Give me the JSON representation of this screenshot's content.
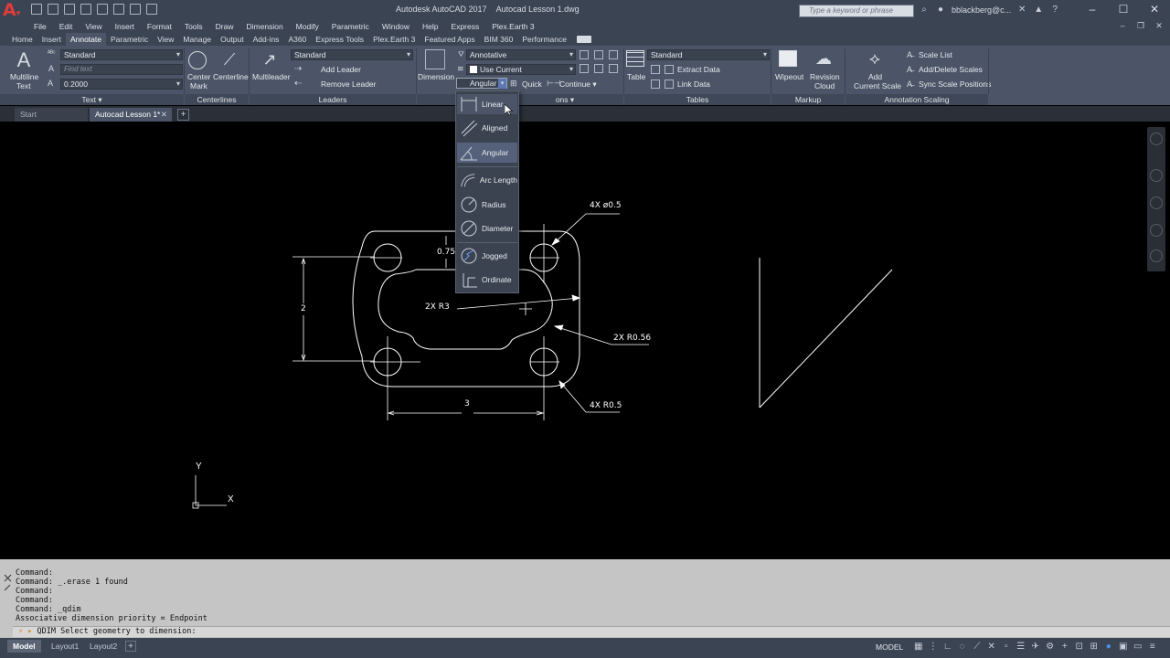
{
  "title": {
    "app_name": "Autodesk AutoCAD 2017",
    "file_name": "Autocad Lesson 1.dwg",
    "search_placeholder": "Type a keyword or phrase",
    "user": "bblackberg@c..."
  },
  "menu": {
    "items": [
      "File",
      "Edit",
      "View",
      "Insert",
      "Format",
      "Tools",
      "Draw",
      "Dimension",
      "Modify",
      "Parametric",
      "Window",
      "Help",
      "Express",
      "Plex.Earth 3"
    ]
  },
  "ribbon_tabs": {
    "items": [
      "Home",
      "Insert",
      "Annotate",
      "Parametric",
      "View",
      "Manage",
      "Output",
      "Add-ins",
      "A360",
      "Express Tools",
      "Plex.Earth 3",
      "Featured Apps",
      "BIM 360",
      "Performance"
    ],
    "active": "Annotate"
  },
  "ribbon": {
    "text_panel": {
      "title": "Text",
      "multiline_text_l1": "Multiline",
      "multiline_text_l2": "Text",
      "style": "Standard",
      "find_placeholder": "Find text",
      "height": "0.2000"
    },
    "centerlines_panel": {
      "title": "Centerlines",
      "center_mark_l1": "Center",
      "center_mark_l2": "Mark",
      "centerline": "Centerline"
    },
    "leaders_panel": {
      "title": "Leaders",
      "multileader": "Multileader",
      "style": "Standard",
      "add_leader": "Add Leader",
      "remove_leader": "Remove Leader"
    },
    "dimensions_panel": {
      "title_tail": "ons",
      "dimension": "Dimension",
      "style": "Annotative",
      "layer": "Use Current",
      "current_type": "Angular",
      "quick": "Quick",
      "continue": "Continue"
    },
    "tables_panel": {
      "title": "Tables",
      "table": "Table",
      "style": "Standard",
      "extract_data": "Extract Data",
      "link_data": "Link Data"
    },
    "markup_panel": {
      "title": "Markup",
      "wipeout": "Wipeout",
      "revision_cloud_l1": "Revision",
      "revision_cloud_l2": "Cloud"
    },
    "annotation_scaling_panel": {
      "title": "Annotation Scaling",
      "add_current_scale_l1": "Add",
      "add_current_scale_l2": "Current Scale",
      "scale_list": "Scale List",
      "add_delete_scales": "Add/Delete Scales",
      "sync_scale_positions": "Sync Scale Positions"
    }
  },
  "doc_tabs": {
    "start": "Start",
    "active": "Autocad Lesson 1*"
  },
  "dimension_dropdown": {
    "items": [
      {
        "label": "Linear",
        "icon": "linear-dim-icon"
      },
      {
        "label": "Aligned",
        "icon": "aligned-dim-icon"
      },
      {
        "label": "Angular",
        "icon": "angular-dim-icon"
      },
      {
        "label": "Arc Length",
        "icon": "arc-length-icon"
      },
      {
        "label": "Radius",
        "icon": "radius-icon"
      },
      {
        "label": "Diameter",
        "icon": "diameter-icon"
      },
      {
        "label": "Jogged",
        "icon": "jogged-icon"
      },
      {
        "label": "Ordinate",
        "icon": "ordinate-icon"
      }
    ],
    "selected": "Angular",
    "hovered": "Linear"
  },
  "drawing": {
    "dim_top": "0.75",
    "dim_left": "2",
    "dim_bottom": "3",
    "note_holes_top": "4X ø0.5",
    "note_slot": "2X R3",
    "note_fillet": "2X R0.56",
    "note_holes_bottom": "4X R0.5",
    "ucs_x": "X",
    "ucs_y": "Y"
  },
  "command": {
    "history": [
      "Command:",
      "Command: _.erase 1 found",
      "Command:",
      "Command:",
      "Command: _qdim",
      "Associative dimension priority = Endpoint"
    ],
    "prompt": "QDIM Select geometry to dimension:"
  },
  "status": {
    "model_tab": "Model",
    "layout1": "Layout1",
    "layout2": "Layout2",
    "space": "MODEL"
  }
}
